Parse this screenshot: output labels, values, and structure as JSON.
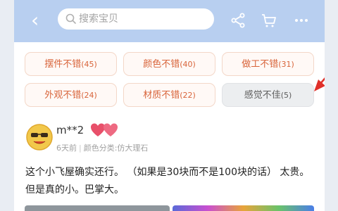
{
  "header": {
    "search_placeholder": "搜索宝贝"
  },
  "tags": [
    {
      "label": "摆件不错",
      "count": "(45)"
    },
    {
      "label": "颜色不错",
      "count": "(40)"
    },
    {
      "label": "做工不错",
      "count": "(31)"
    },
    {
      "label": "外观不错",
      "count": "(24)"
    },
    {
      "label": "材质不错",
      "count": "(22)"
    },
    {
      "label": "感觉不佳",
      "count": "(5)"
    }
  ],
  "review": {
    "user_name": "m**2",
    "time": "6天前",
    "sku": "颜色分类:仿大理石",
    "text": "这个小飞屋确实还行。 （如果是30块而不是100块的话） 太贵。 但是真的小。巴掌大。"
  },
  "colors": {
    "header_bg": "#b8cff0",
    "tag_text": "#d8643a",
    "tag_border": "#f3d7c8",
    "negative_tag_bg": "#eceef0",
    "annotation_arrow": "#e0302a"
  },
  "icons": [
    "back-icon",
    "search-icon",
    "share-icon",
    "cart-icon",
    "more-icon",
    "avatar-icon",
    "hearts-icon",
    "arrow-annotation"
  ]
}
